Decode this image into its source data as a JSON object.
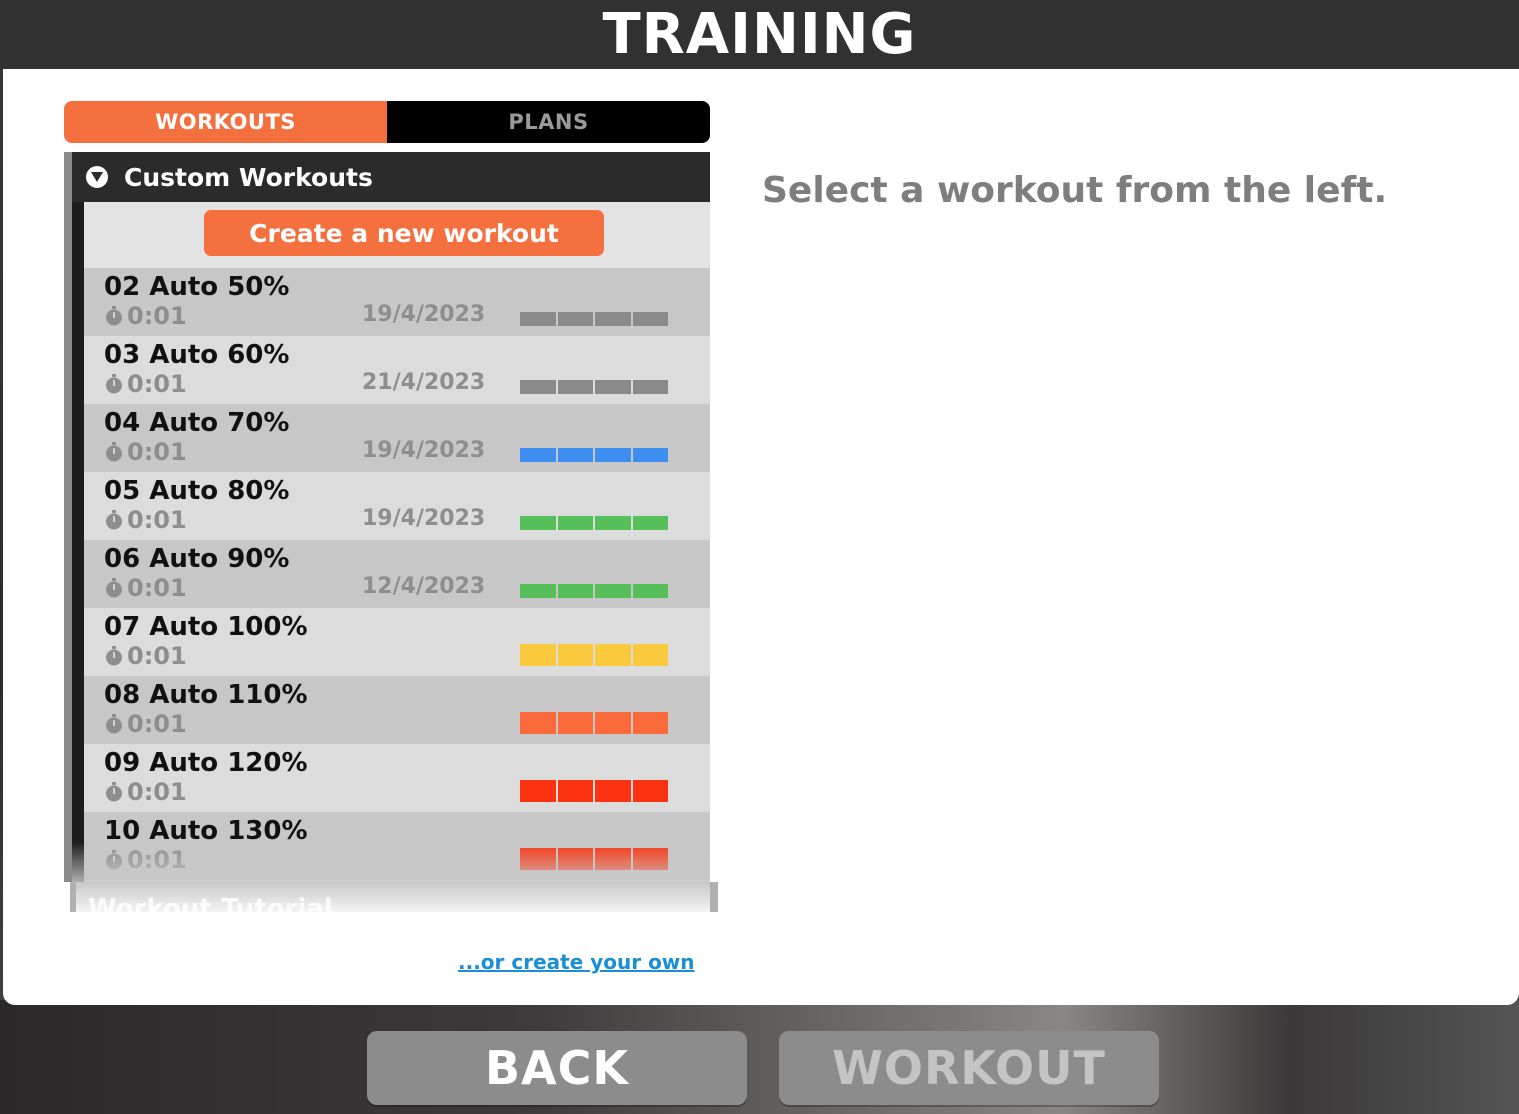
{
  "header": {
    "title": "TRAINING"
  },
  "tabs": [
    {
      "label": "WORKOUTS",
      "active": true
    },
    {
      "label": "PLANS",
      "active": false
    }
  ],
  "section": {
    "title": "Custom Workouts",
    "create_button": "Create a new workout",
    "next_section_title": "Workout Tutorial"
  },
  "workouts": [
    {
      "name": "02 Auto 50%",
      "duration": "0:01",
      "date": "19/4/2023",
      "zone_color": "#8a8a8a"
    },
    {
      "name": "03 Auto 60%",
      "duration": "0:01",
      "date": "21/4/2023",
      "zone_color": "#8a8a8a"
    },
    {
      "name": "04 Auto 70%",
      "duration": "0:01",
      "date": "19/4/2023",
      "zone_color": "#3d8ef0"
    },
    {
      "name": "05 Auto 80%",
      "duration": "0:01",
      "date": "19/4/2023",
      "zone_color": "#56bf5a"
    },
    {
      "name": "06 Auto 90%",
      "duration": "0:01",
      "date": "12/4/2023",
      "zone_color": "#56bf5a"
    },
    {
      "name": "07 Auto 100%",
      "duration": "0:01",
      "date": "",
      "zone_color": "#fbc93d"
    },
    {
      "name": "08 Auto 110%",
      "duration": "0:01",
      "date": "",
      "zone_color": "#fb6a3b"
    },
    {
      "name": "09 Auto 120%",
      "duration": "0:01",
      "date": "",
      "zone_color": "#fb3311"
    },
    {
      "name": "10 Auto 130%",
      "duration": "0:01",
      "date": "",
      "zone_color": "#fb3311"
    }
  ],
  "links": {
    "create_own": "...or create your own"
  },
  "detail": {
    "hint": "Select a workout from the left."
  },
  "buttons": {
    "back": "BACK",
    "workout": "WORKOUT"
  },
  "colors": {
    "accent": "#f4703f",
    "header_bg": "#313131"
  }
}
